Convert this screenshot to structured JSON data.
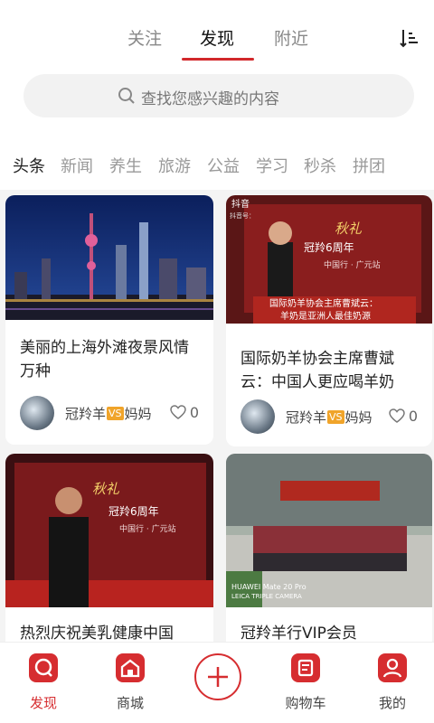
{
  "header": {
    "tabs": [
      {
        "label": "关注"
      },
      {
        "label": "发现"
      },
      {
        "label": "附近"
      }
    ]
  },
  "search": {
    "placeholder": "查找您感兴趣的内容"
  },
  "categories": [
    "头条",
    "新闻",
    "养生",
    "旅游",
    "公益",
    "学习",
    "秒杀",
    "拼团"
  ],
  "feed": [
    {
      "title": "美丽的上海外滩夜景风情万种",
      "author_left": "冠羚羊",
      "vs": "VS",
      "author_right": "妈妈",
      "likes": "0",
      "image_texts": []
    },
    {
      "title": "国际奶羊协会主席曹斌云：中国人更应喝羊奶",
      "author_left": "冠羚羊",
      "vs": "VS",
      "author_right": "妈妈",
      "likes": "0",
      "image_texts": [
        "抖音",
        "抖音号：",
        "秋礼",
        "冠羚6周年",
        "中国行 · 广元站",
        "国际奶羊协会主席曹斌云：",
        "羊奶是亚洲人最佳奶源"
      ]
    },
    {
      "title": "热烈庆祝美乳健康中国",
      "image_texts": [
        "秋礼",
        "冠羚6周年",
        "中国行 · 广元站"
      ]
    },
    {
      "title": "冠羚羊行VIP会员",
      "image_texts": [
        "HUAWEI Mate 20 Pro",
        "LEICA TRIPLE CAMERA"
      ]
    }
  ],
  "bottom_nav": [
    {
      "label": "发现"
    },
    {
      "label": "商城"
    },
    {
      "label": "购物车"
    },
    {
      "label": "我的"
    }
  ],
  "colors": {
    "accent": "#d62d30",
    "badge": "#f0a42a"
  }
}
